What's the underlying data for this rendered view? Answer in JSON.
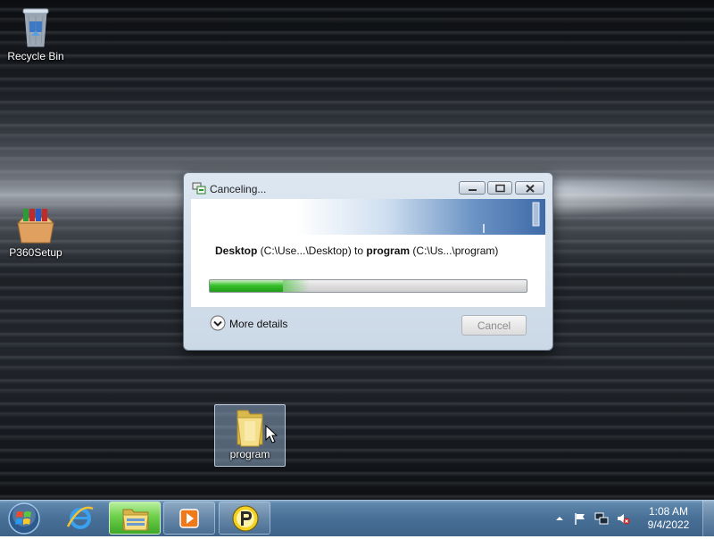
{
  "desktop": {
    "icons": [
      {
        "label": "Recycle Bin",
        "icon": "recycle-bin-icon"
      },
      {
        "label": "P360Setup",
        "icon": "package-icon"
      },
      {
        "label": "program",
        "icon": "folder-icon"
      }
    ]
  },
  "dialog": {
    "title": "Canceling...",
    "copy_line": {
      "source_name": "Desktop",
      "source_path": " (C:\\Use...\\Desktop) ",
      "to": " to ",
      "dest_name": "program",
      "dest_path": " (C:\\Us...\\program)"
    },
    "progress_percent": 23,
    "more_details_label": "More details",
    "cancel_label": "Cancel"
  },
  "taskbar": {
    "pinned": [
      {
        "name": "internet-explorer",
        "icon": "ie-icon"
      },
      {
        "name": "windows-explorer",
        "icon": "folder-icon",
        "active": true
      },
      {
        "name": "windows-media-player",
        "icon": "media-player-icon"
      },
      {
        "name": "p360",
        "icon": "p360-icon"
      }
    ],
    "clock": {
      "time": "1:08 AM",
      "date": "9/4/2022"
    }
  },
  "colors": {
    "progress_green": "#37c02b",
    "taskbar_blue": "#486f96",
    "explorer_active": "#6ecf4a"
  }
}
